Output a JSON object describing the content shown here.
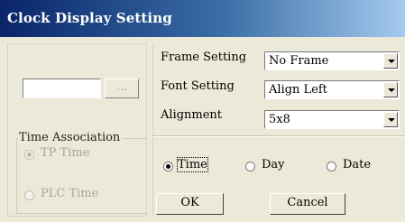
{
  "window": {
    "title": "Clock Display Setting"
  },
  "left": {
    "browse_label": "...",
    "time_association": {
      "label": "Time Association",
      "options": [
        "TP Time",
        "PLC Time"
      ],
      "selected": "TP Time"
    }
  },
  "settings": {
    "frame": {
      "label": "Frame Setting",
      "value": "No Frame"
    },
    "font": {
      "label": "Font Setting",
      "value": "Align Left"
    },
    "alignment": {
      "label": "Alignment",
      "value": "5x8"
    }
  },
  "display": {
    "options": [
      "Time",
      "Day",
      "Date"
    ],
    "selected": "Time"
  },
  "buttons": {
    "ok": "OK",
    "cancel": "Cancel"
  }
}
